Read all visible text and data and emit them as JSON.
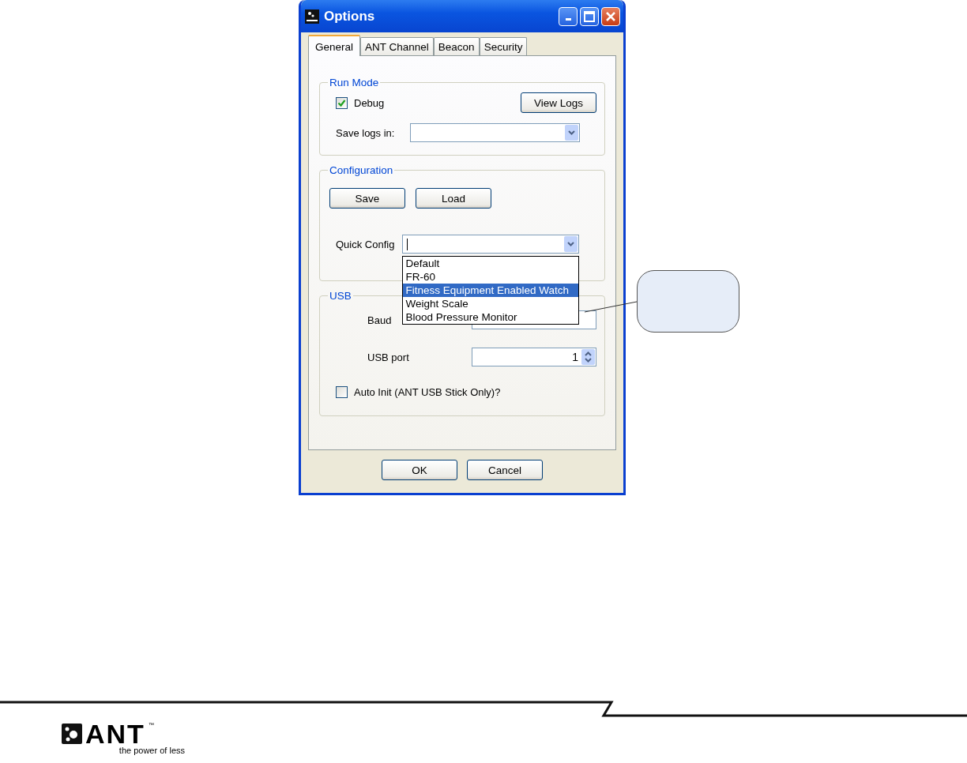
{
  "window": {
    "title": "Options"
  },
  "tabs": [
    {
      "label": "General",
      "selected": true
    },
    {
      "label": "ANT Channel",
      "selected": false
    },
    {
      "label": "Beacon",
      "selected": false
    },
    {
      "label": "Security",
      "selected": false
    }
  ],
  "run_mode": {
    "title": "Run Mode",
    "debug": {
      "label": "Debug",
      "checked": true
    },
    "view_logs_button": "View Logs",
    "save_logs": {
      "label": "Save logs in:"
    }
  },
  "configuration": {
    "title": "Configuration",
    "buttons": [
      "Save",
      "Load"
    ],
    "quick_config": {
      "label": "Quick Config",
      "expanded": true,
      "options": [
        {
          "label": "Default",
          "selected": false
        },
        {
          "label": "FR-60",
          "selected": false
        },
        {
          "label": "Fitness Equipment Enabled Watch",
          "selected": true
        },
        {
          "label": "Weight Scale",
          "selected": false
        },
        {
          "label": "Blood Pressure Monitor",
          "selected": false
        }
      ]
    }
  },
  "usb": {
    "title": "USB",
    "baud_rate": {
      "label": "Baud"
    },
    "usb_port": {
      "label": "USB port",
      "value": "1"
    },
    "auto_init": {
      "label": "Auto Init (ANT USB Stick Only)?",
      "checked": false
    }
  },
  "buttons": [
    "OK",
    "Cancel"
  ],
  "footer": {
    "logo": "ANT",
    "trademark": "™",
    "tagline": "the power of less"
  }
}
